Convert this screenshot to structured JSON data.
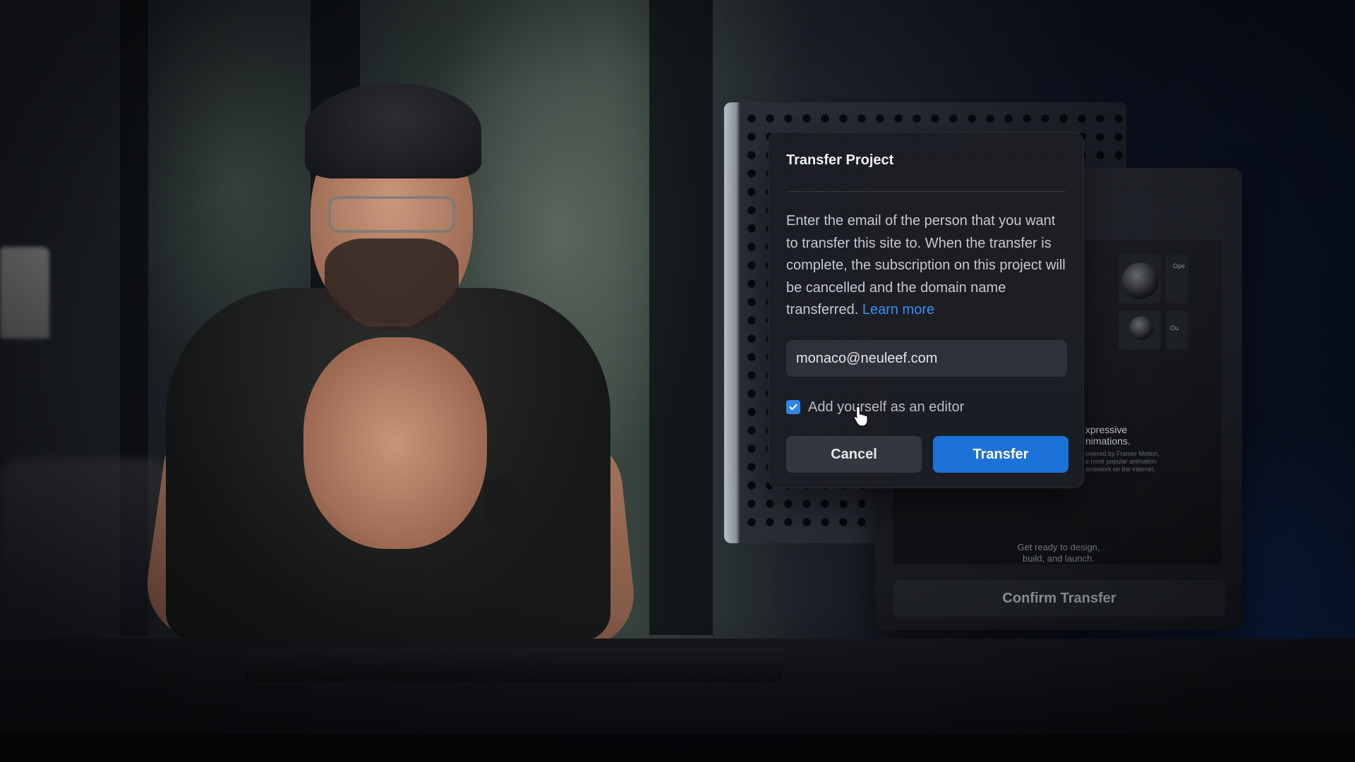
{
  "dialog": {
    "title": "Transfer Project",
    "description": "Enter the email of the person that you want to transfer this site to. When the transfer is complete, the subscription on this project will be cancelled and the domain name transferred.",
    "learn_more": "Learn more",
    "email_value": "monaco@neuleef.com",
    "checkbox_label": "Add yourself as an editor",
    "checkbox_checked": true,
    "cancel_label": "Cancel",
    "transfer_label": "Transfer"
  },
  "monitor": {
    "heading": "xpressive\nnimations.",
    "subtext": "owered by Framer Motion,\ne most popular animation\namework on the internet.",
    "tag_top": "Ope",
    "tag_bottom": "Ou",
    "ready_text": "Get ready to design,\nbuild, and launch.",
    "confirm_label": "Confirm Transfer"
  },
  "colors": {
    "accent": "#1d72d8",
    "link": "#3b8ef0",
    "dialog_bg": "#1c1e24"
  },
  "icons": {
    "checkbox": "checkmark-icon",
    "cursor": "hand-pointer-icon"
  }
}
